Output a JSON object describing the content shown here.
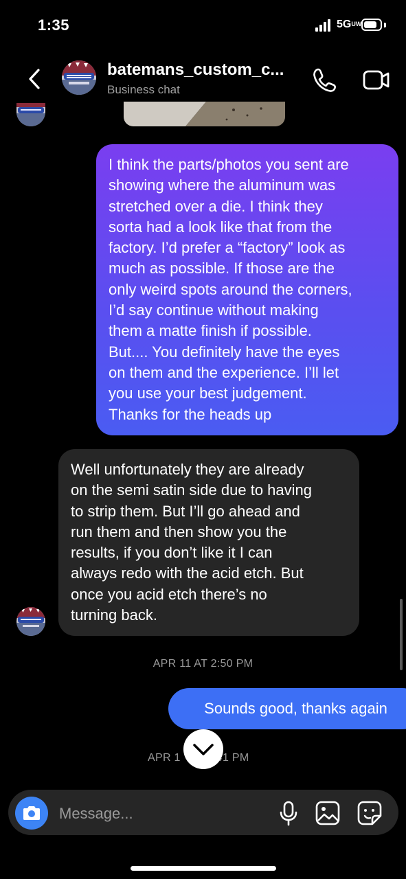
{
  "status_bar": {
    "time": "1:35",
    "network": "5G",
    "network_sub": "UW"
  },
  "header": {
    "name": "batemans_custom_c...",
    "subtitle": "Business chat",
    "avatar_logo_text": "Bateman's Custom Coatings"
  },
  "messages": [
    {
      "direction": "outgoing",
      "lines": [
        "I think the parts/photos you sent are",
        "showing where the aluminum was",
        "stretched over a die. I think they",
        "sorta had a look like that from the",
        "factory. I’d prefer a “factory” look as",
        "much as possible. If those are the",
        "only weird spots around the corners,",
        "I’d say continue without making",
        "them a matte finish if possible.",
        "But.... You definitely have the eyes",
        "on them and the experience. I’ll let",
        "you use your best judgement.",
        "Thanks for the heads up"
      ]
    },
    {
      "direction": "incoming",
      "lines": [
        "Well unfortunately they are already",
        "on the semi satin side due to having",
        "to strip them. But I’ll go ahead and",
        "run them and then show you the",
        "results, if you don’t like it I can",
        "always redo with the acid etch. But",
        "once you acid etch there’s no",
        "turning back."
      ]
    },
    {
      "direction": "timestamp",
      "text": "APR 11 AT 2:50 PM"
    },
    {
      "direction": "outgoing",
      "text": "Sounds good, thanks again"
    },
    {
      "direction": "timestamp",
      "text_left": "APR 1",
      "text_right": "41 PM"
    }
  ],
  "composer": {
    "placeholder": "Message..."
  },
  "icons": {
    "back": "chevron-left-icon",
    "call": "phone-icon",
    "video": "video-camera-icon",
    "camera": "camera-icon",
    "mic": "microphone-icon",
    "gallery": "image-icon",
    "sticker": "sticker-icon",
    "scroll": "chevron-down-icon"
  },
  "colors": {
    "outgoing_top": "#7a3ef0",
    "outgoing_bottom": "#4a5cf2",
    "outgoing_short": "#3d6ff5",
    "incoming": "#262626",
    "camera_button": "#3d84f5"
  }
}
